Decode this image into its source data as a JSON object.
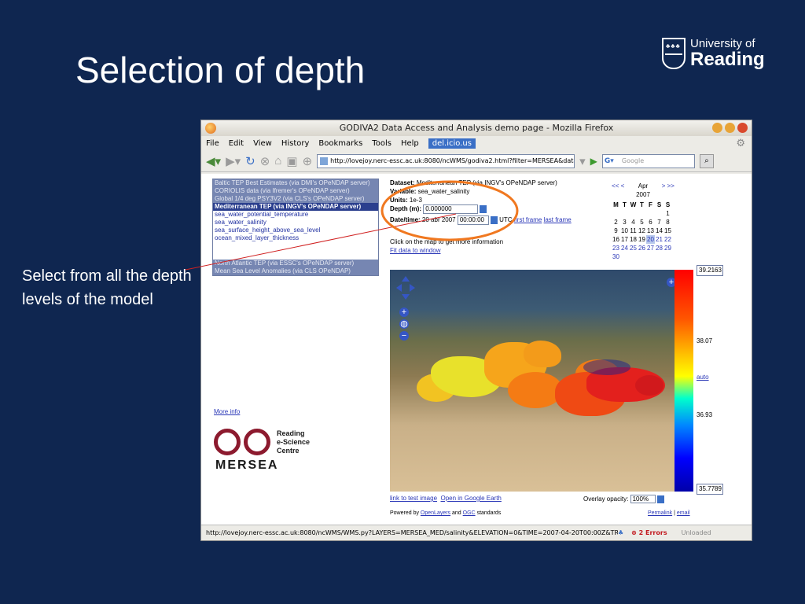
{
  "slide": {
    "title": "Selection of depth",
    "caption": "Select from all the depth levels of the model",
    "logo_line1": "University of",
    "logo_line2": "Reading"
  },
  "browser": {
    "window_title": "GODIVA2 Data Access and Analysis demo page - Mozilla Firefox",
    "menu": [
      "File",
      "Edit",
      "View",
      "History",
      "Bookmarks",
      "Tools",
      "Help",
      "del.icio.us"
    ],
    "url": "http://lovejoy.nerc-essc.ac.uk:8080/ncWMS/godiva2.html?filter=MERSEA&datase",
    "search_placeholder": "Google",
    "status_url": "http://lovejoy.nerc-essc.ac.uk:8080/ncWMS/WMS.py?LAYERS=MERSEA_MED/salinity&ELEVATION=0&TIME=2007-04-20T00:00Z&TRANS...",
    "errors": "2 Errors",
    "unloaded": "Unloaded"
  },
  "layers": {
    "datasets_top": [
      "Baltic TEP Best Estimates (via DMI's OPeNDAP server)",
      "CORIOLIS data (via Ifremer's OPeNDAP server)",
      "Global 1/4 deg PSY3V2 (via CLS's OPeNDAP server)"
    ],
    "selected": "Mediterranean TEP (via INGV's OPeNDAP server)",
    "variables": [
      "sea_water_potential_temperature",
      "sea_water_salinity",
      "sea_surface_height_above_sea_level",
      "ocean_mixed_layer_thickness"
    ],
    "datasets_bottom": [
      "North Atlantic TEP (via ESSC's OPeNDAP server)",
      "Mean Sea Level Anomalies (via CLS OPeNDAP)"
    ]
  },
  "info": {
    "dataset_label": "Dataset:",
    "dataset_value": "Mediterranean TEP (via INGV's OPeNDAP server)",
    "variable_label": "Variable:",
    "variable_value": "sea_water_salinity",
    "units_label": "Units:",
    "units_value": "1e-3",
    "depth_label": "Depth (m):",
    "depth_value": "0.000000",
    "datetime_label": "Date/time:",
    "date_value": "20 abr 2007",
    "time_value": "00:00:00",
    "utc": "UTC",
    "first_frame": "first frame",
    "last_frame": "last frame",
    "click_text": "Click on the map to get more information",
    "fit_link": "Fit data to window"
  },
  "calendar": {
    "prev": "<< <",
    "next": "> >>",
    "month": "Apr",
    "year": "2007",
    "dow": [
      "M",
      "T",
      "W",
      "T",
      "F",
      "S",
      "S"
    ],
    "days": [
      "",
      "",
      "",
      "",
      "",
      "",
      "1",
      "2",
      "3",
      "4",
      "5",
      "6",
      "7",
      "8",
      "9",
      "10",
      "11",
      "12",
      "13",
      "14",
      "15",
      "16",
      "17",
      "18",
      "19",
      "20",
      "21",
      "22",
      "23",
      "24",
      "25",
      "26",
      "27",
      "28",
      "29",
      "30"
    ],
    "links_from": 20
  },
  "scale": {
    "max": "39.2163",
    "mid_high": "38.07",
    "auto": "auto",
    "mid_low": "36.93",
    "min": "35.7789"
  },
  "below_map": {
    "test_image": "link to test image",
    "google_earth": "Open in Google Earth",
    "overlay_label": "Overlay opacity:",
    "overlay_value": "100%",
    "powered_prefix": "Powered by",
    "openlayers": "OpenLayers",
    "and": "and",
    "ogc": "OGC",
    "standards": "standards",
    "permalink": "Permalink",
    "email": "email"
  },
  "sidebar": {
    "more_info": "More info",
    "resc_line1": "Reading",
    "resc_line2": "e-Science",
    "resc_line3": "Centre",
    "mersea": "MERSEA"
  },
  "colors": {
    "slide_bg": "#0f2650",
    "highlight_circle": "#f07820",
    "callout_line": "#d02020"
  }
}
